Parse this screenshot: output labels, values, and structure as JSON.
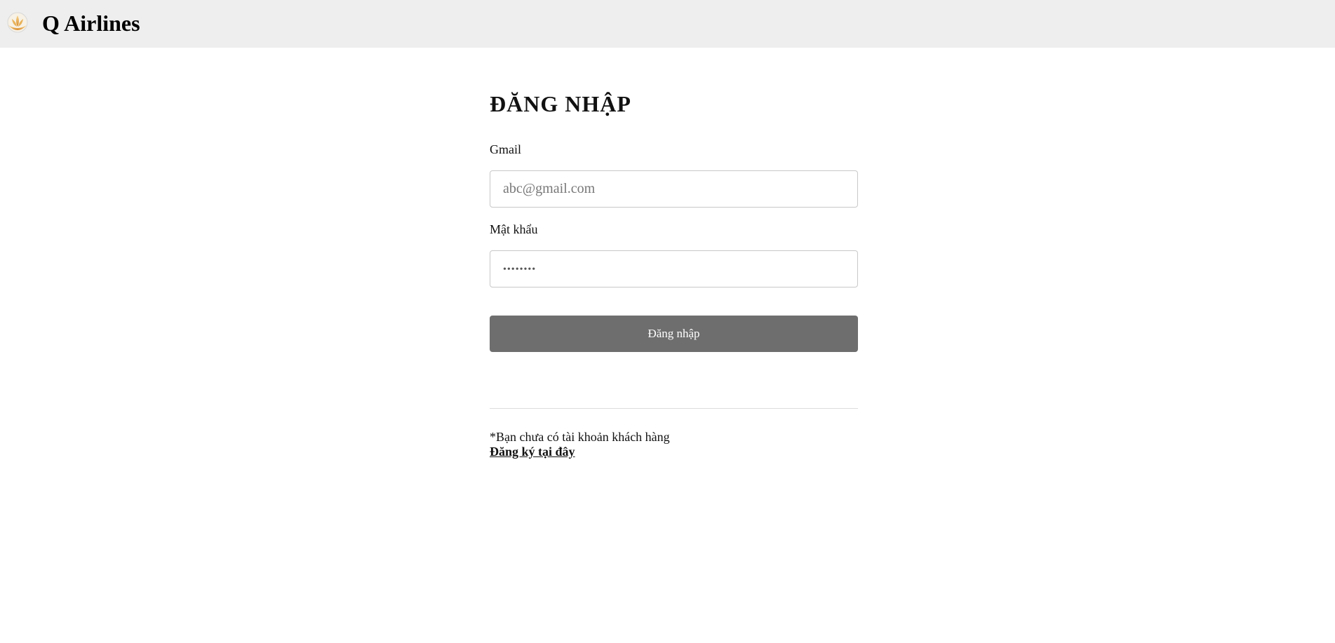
{
  "header": {
    "brand_name": "Q Airlines",
    "logo_icon": "lotus-sun-logo-icon",
    "logo_colors": [
      "#f2c36b",
      "#d98a2b",
      "#c9c9c9"
    ]
  },
  "login": {
    "title": "ĐĂNG NHẬP",
    "email_label": "Gmail",
    "email_placeholder": "abc@gmail.com",
    "email_value": "",
    "password_label": "Mật khẩu",
    "password_value": "••••••••",
    "submit_label": "Đăng nhập",
    "signup_prompt": "*Bạn chưa có tài khoản khách hàng",
    "signup_link": "Đăng ký tại đây"
  },
  "colors": {
    "topbar_bg": "#eeeeee",
    "button_bg": "#6e6e6e",
    "button_text": "#ffffff"
  }
}
